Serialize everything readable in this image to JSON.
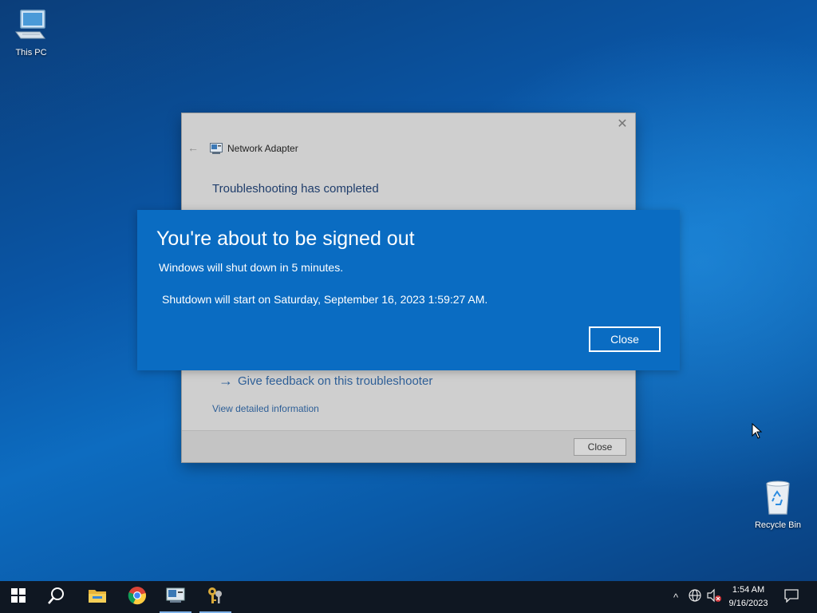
{
  "desktop": {
    "icons": [
      {
        "label": "This PC"
      },
      {
        "label": "Recycle Bin"
      }
    ]
  },
  "troubleshooter": {
    "back_symbol": "←",
    "title": "Network Adapter",
    "heading": "Troubleshooting has completed",
    "feedback_arrow": "→",
    "feedback_link": "Give feedback on this troubleshooter",
    "details_link": "View detailed information",
    "close_button": "Close",
    "close_x": "✕"
  },
  "signout_dialog": {
    "title": "You're about to be signed out",
    "message": "Windows will shut down in 5 minutes.",
    "shutdown_time": "Shutdown will start on Saturday, September 16, 2023 1:59:27 AM.",
    "close_button": "Close",
    "background_color": "#0a6cc2"
  },
  "taskbar": {
    "items": [
      {
        "icon": "windows-start-icon"
      },
      {
        "icon": "search-icon"
      },
      {
        "icon": "file-explorer-icon"
      },
      {
        "icon": "chrome-icon"
      },
      {
        "icon": "network-adapter-troubleshooter-icon"
      },
      {
        "icon": "keys-app-icon"
      }
    ],
    "tray": {
      "chevron": "^",
      "clock_time": "1:54 AM",
      "clock_date": "9/16/2023"
    }
  }
}
